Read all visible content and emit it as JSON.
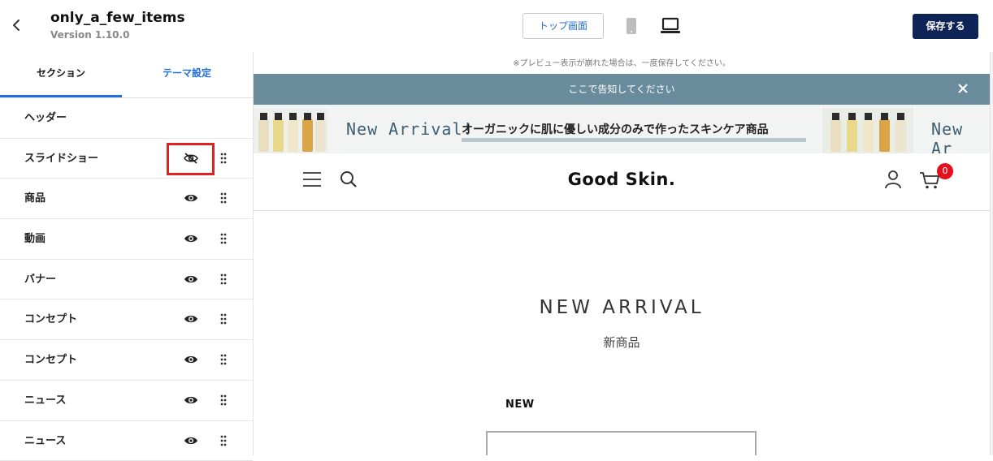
{
  "header": {
    "title": "only_a_few_items",
    "version": "Version 1.10.0",
    "top_screen_label": "トップ画面",
    "save_label": "保存する"
  },
  "sidebar": {
    "tabs": [
      {
        "label": "セクション",
        "active": true
      },
      {
        "label": "テーマ設定",
        "active": false
      }
    ],
    "items": [
      {
        "label": "ヘッダー",
        "visible": true,
        "has_controls": false
      },
      {
        "label": "スライドショー",
        "visible": false,
        "has_controls": true,
        "highlighted": true
      },
      {
        "label": "商品",
        "visible": true,
        "has_controls": true
      },
      {
        "label": "動画",
        "visible": true,
        "has_controls": true
      },
      {
        "label": "バナー",
        "visible": true,
        "has_controls": true
      },
      {
        "label": "コンセプト",
        "visible": true,
        "has_controls": true
      },
      {
        "label": "コンセプト",
        "visible": true,
        "has_controls": true
      },
      {
        "label": "ニュース",
        "visible": true,
        "has_controls": true
      },
      {
        "label": "ニュース",
        "visible": true,
        "has_controls": true
      }
    ]
  },
  "preview": {
    "note": "※プレビュー表示が崩れた場合は、一度保存してください。",
    "notice": "ここで告知してください",
    "banner_en": "New Arrival!",
    "banner_en_repeat": "New Ar",
    "banner_jp": "オーガニックに肌に優しい成分のみで作ったスキンケア商品",
    "logo": "Good Skin.",
    "cart_count": "0",
    "section_title": "NEW ARRIVAL",
    "section_subtitle": "新商品",
    "new_label": "NEW"
  },
  "colors": {
    "accent": "#1f6fe0",
    "save_button": "#0e2356",
    "notice_bar": "#6a8b9c",
    "badge": "#e4101d",
    "highlight": "#e1211f"
  },
  "icons": [
    "chevron-left-icon",
    "mobile-icon",
    "laptop-icon",
    "eye-icon",
    "eye-slash-icon",
    "drag-handle-icon",
    "close-icon",
    "menu-icon",
    "search-icon",
    "user-icon",
    "cart-icon"
  ]
}
